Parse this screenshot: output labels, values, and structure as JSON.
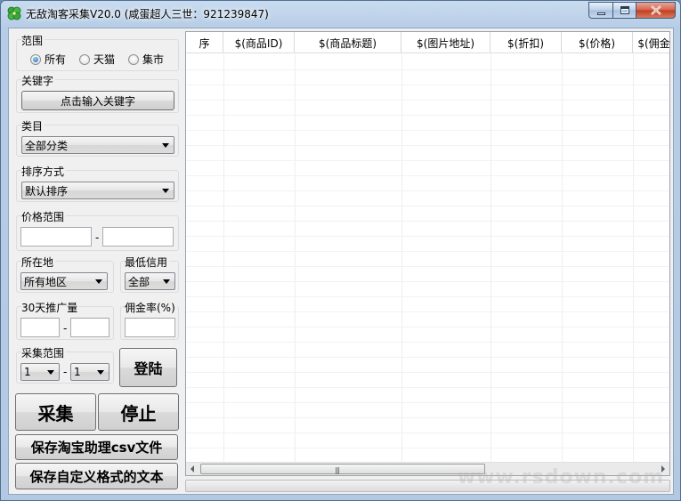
{
  "window": {
    "title": "无敌淘客采集V20.0 (咸蛋超人三世：921239847)"
  },
  "range_group": {
    "label": "范围",
    "options": [
      {
        "label": "所有",
        "selected": true
      },
      {
        "label": "天猫",
        "selected": false
      },
      {
        "label": "集市",
        "selected": false
      }
    ]
  },
  "keyword_group": {
    "label": "关键字",
    "button_label": "点击输入关键字"
  },
  "category_group": {
    "label": "类目",
    "selected": "全部分类"
  },
  "sort_group": {
    "label": "排序方式",
    "selected": "默认排序"
  },
  "price_group": {
    "label": "价格范围",
    "separator": "-"
  },
  "location_group": {
    "label": "所在地",
    "selected": "所有地区"
  },
  "credit_group": {
    "label": "最低信用",
    "selected": "全部"
  },
  "promo_group": {
    "label": "30天推广量",
    "separator": "-"
  },
  "commission_group": {
    "label": "佣金率(%)"
  },
  "collect_range_group": {
    "label": "采集范围",
    "from": "1",
    "to": "1",
    "separator": "-"
  },
  "buttons": {
    "login": "登陆",
    "collect": "采集",
    "stop": "停止",
    "save_csv": "保存淘宝助理csv文件",
    "save_custom": "保存自定义格式的文本"
  },
  "table": {
    "columns": [
      "序",
      "$(商品ID)",
      "$(商品标题)",
      "$(图片地址)",
      "$(折扣)",
      "$(价格)",
      "$(佣金比"
    ]
  },
  "watermark": "www.rsdown.com"
}
